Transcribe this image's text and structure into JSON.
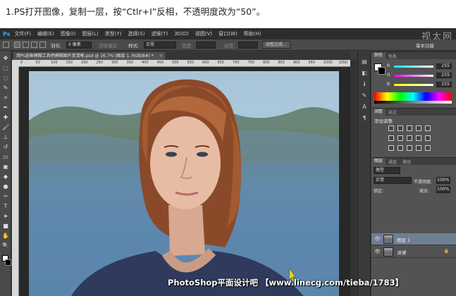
{
  "caption": "1.PS打开图像，复制一层，按“Ctlr+I”反相，不透明度改为“50”。",
  "app": {
    "logo": "Ps",
    "menu": [
      "文件(F)",
      "编辑(E)",
      "图像(I)",
      "图层(L)",
      "类型(Y)",
      "选择(S)",
      "滤镜(T)",
      "3D(D)",
      "视图(V)",
      "窗口(W)",
      "帮助(H)"
    ],
    "watermark": "视太网",
    "workspace": "基本功能"
  },
  "options_bar": {
    "feather_label": "羽化:",
    "feather_value": "0 像素",
    "antialias_label": "消除锯齿",
    "style_label": "样式:",
    "style_value": "正常",
    "width_label": "宽度:",
    "height_label": "高度:",
    "refine_button": "调整边缘..."
  },
  "document": {
    "tab_title": "用Ps选框模糊工具把模糊图片变清晰.psd @ 16.7% (图层 1, RGB/8#) *",
    "ruler_ticks": [
      "0",
      "50",
      "100",
      "150",
      "200",
      "250",
      "300",
      "350",
      "400",
      "450",
      "500",
      "550",
      "600",
      "650",
      "700",
      "750",
      "800",
      "850",
      "900",
      "950",
      "1000",
      "1050"
    ]
  },
  "color_panel": {
    "tabs": [
      "颜色",
      "色板"
    ],
    "channels": [
      {
        "label": "R",
        "value": "255",
        "color": "#ff4040"
      },
      {
        "label": "G",
        "value": "255",
        "color": "#40ff40"
      },
      {
        "label": "B",
        "value": "255",
        "color": "#4060ff"
      }
    ]
  },
  "adjustments_panel": {
    "tabs": [
      "调整",
      "样式"
    ],
    "title": "添加调整"
  },
  "layers_panel": {
    "tabs": [
      "图层",
      "通道",
      "路径"
    ],
    "kind_label": "类型",
    "blend_mode": "正常",
    "opacity_label": "不透明度:",
    "opacity_value": "100%",
    "lock_label": "锁定:",
    "fill_label": "填充:",
    "fill_value": "100%",
    "layers": [
      {
        "name": "图层 1",
        "selected": true
      },
      {
        "name": "背景",
        "selected": false,
        "locked": true
      }
    ]
  },
  "footer_credit": "PhotoShop平面设计吧 【www.linecg.com/tieba/1783】"
}
